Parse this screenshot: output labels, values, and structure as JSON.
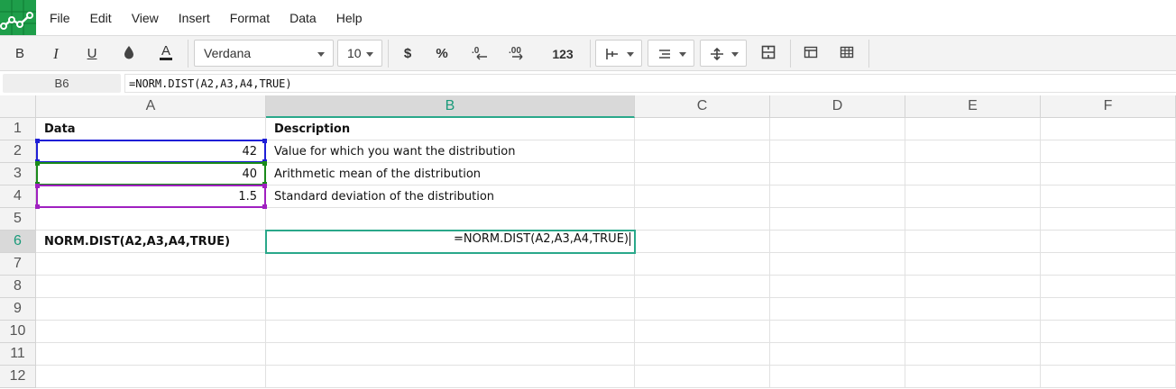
{
  "menu": {
    "items": [
      "File",
      "Edit",
      "View",
      "Insert",
      "Format",
      "Data",
      "Help"
    ]
  },
  "toolbar": {
    "bold_label": "B",
    "italic_label": "I",
    "underline_label": "U",
    "font_family": "Verdana",
    "font_size": "10",
    "currency_label": "$",
    "percent_label": "%",
    "decimal_decrease_label": ".0",
    "decimal_increase_label": ".00",
    "number_format_label": "123",
    "icons": [
      "fill-color-icon",
      "text-color-icon",
      "borders-icon",
      "align-icon",
      "valign-icon",
      "merge-icon",
      "freeze-icon",
      "grid-icon"
    ],
    "text_color_accent": "#222222"
  },
  "formula_bar": {
    "cell_ref": "B6",
    "formula": "=NORM.DIST(A2,A3,A4,TRUE)"
  },
  "sheet": {
    "columns": [
      "A",
      "B",
      "C",
      "D",
      "E",
      "F"
    ],
    "active_column": "B",
    "rows": [
      "1",
      "2",
      "3",
      "4",
      "5",
      "6",
      "7",
      "8",
      "9",
      "10",
      "11",
      "12"
    ],
    "active_row": "6",
    "cells": {
      "A1": "Data",
      "B1": "Description",
      "A2": "42",
      "B2": "Value for which you want the distribution",
      "A3": "40",
      "B3": "Arithmetic mean of the distribution",
      "A4": "1.5",
      "B4": "Standard deviation of the distribution",
      "A6": "NORM.DIST(A2,A3,A4,TRUE)",
      "B6_edit": "=NORM.DIST(A2,A3,A4,TRUE)"
    },
    "range_colors": {
      "A2": "#1f1fd6",
      "A3": "#1a8a1a",
      "A4": "#a020c0",
      "selection": "#2aa88a"
    }
  }
}
